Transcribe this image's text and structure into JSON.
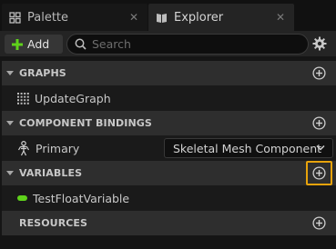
{
  "tabs": [
    {
      "label": "Palette",
      "icon": "palette-icon"
    },
    {
      "label": "Explorer",
      "icon": "book-icon"
    }
  ],
  "toolbar": {
    "add_label": "Add",
    "search_placeholder": "Search"
  },
  "categories": {
    "graphs": {
      "title": "GRAPHS",
      "items": [
        {
          "label": "UpdateGraph",
          "icon": "graph-grid-icon"
        }
      ]
    },
    "component_bindings": {
      "title": "COMPONENT BINDINGS",
      "items": [
        {
          "label": "Primary",
          "icon": "skeleton-icon",
          "type_value": "Skeletal Mesh Component"
        }
      ]
    },
    "variables": {
      "title": "VARIABLES",
      "items": [
        {
          "label": "TestFloatVariable",
          "icon": "float-pill-icon"
        }
      ]
    },
    "resources": {
      "title": "RESOURCES",
      "items": []
    }
  },
  "colors": {
    "accent_add": "#5fd21b",
    "focus_highlight": "#e8a30b",
    "float_type": "#5fd21b"
  }
}
